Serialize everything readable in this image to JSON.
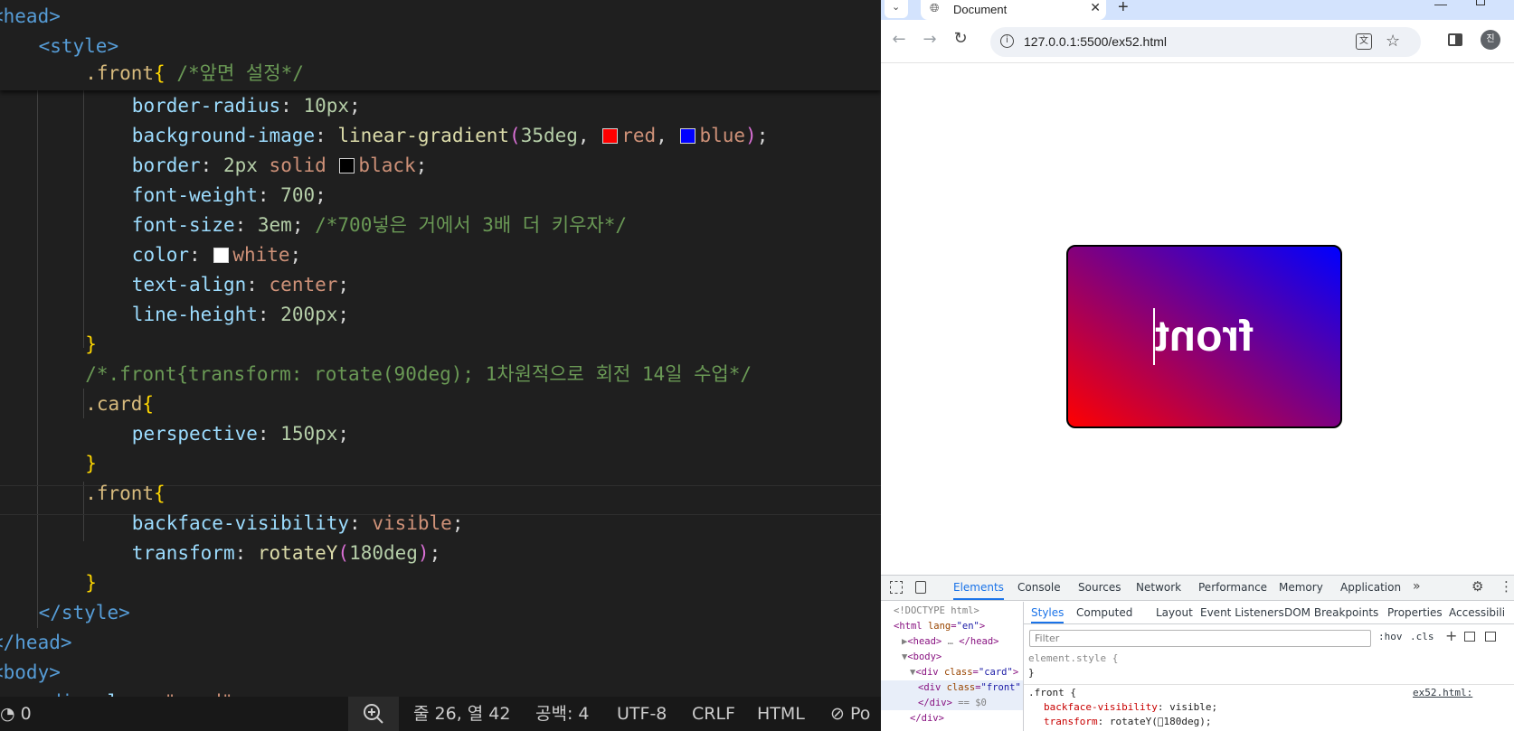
{
  "editor": {
    "lines": [
      {
        "indent": 0,
        "tokens": [
          [
            "tag",
            "<head>"
          ]
        ]
      },
      {
        "indent": 1,
        "tokens": [
          [
            "tag",
            "<style>"
          ]
        ]
      },
      {
        "indent": 2,
        "tokens": [
          [
            "sel",
            ".front"
          ],
          [
            "brace",
            "{"
          ],
          [
            "txt",
            " "
          ],
          [
            "cmt",
            "/*앞면 설정*/"
          ]
        ]
      },
      {
        "indent": 3,
        "tokens": [
          [
            "prop",
            "border-radius"
          ],
          [
            "txt",
            ": "
          ],
          [
            "num",
            "10px"
          ],
          [
            "txt",
            ";"
          ]
        ]
      },
      {
        "indent": 3,
        "tokens": [
          [
            "prop",
            "background-image"
          ],
          [
            "txt",
            ": "
          ],
          [
            "fn",
            "linear-gradient"
          ],
          [
            "paren",
            "("
          ],
          [
            "num",
            "35deg"
          ],
          [
            "txt",
            ", "
          ],
          [
            "swatch",
            "#ff0000"
          ],
          [
            "val",
            "red"
          ],
          [
            "txt",
            ", "
          ],
          [
            "swatch",
            "#0000ff"
          ],
          [
            "val",
            "blue"
          ],
          [
            "paren",
            ")"
          ],
          [
            "txt",
            ";"
          ]
        ]
      },
      {
        "indent": 3,
        "tokens": [
          [
            "prop",
            "border"
          ],
          [
            "txt",
            ": "
          ],
          [
            "num",
            "2px"
          ],
          [
            "txt",
            " "
          ],
          [
            "val",
            "solid"
          ],
          [
            "txt",
            " "
          ],
          [
            "swatch",
            "#000000"
          ],
          [
            "val",
            "black"
          ],
          [
            "txt",
            ";"
          ]
        ]
      },
      {
        "indent": 3,
        "tokens": [
          [
            "prop",
            "font-weight"
          ],
          [
            "txt",
            ": "
          ],
          [
            "num",
            "700"
          ],
          [
            "txt",
            ";"
          ]
        ]
      },
      {
        "indent": 3,
        "tokens": [
          [
            "prop",
            "font-size"
          ],
          [
            "txt",
            ": "
          ],
          [
            "num",
            "3em"
          ],
          [
            "txt",
            "; "
          ],
          [
            "cmt",
            "/*700넣은 거에서 3배 더 키우자*/"
          ]
        ]
      },
      {
        "indent": 3,
        "tokens": [
          [
            "prop",
            "color"
          ],
          [
            "txt",
            ": "
          ],
          [
            "swatch",
            "#ffffff"
          ],
          [
            "val",
            "white"
          ],
          [
            "txt",
            ";"
          ]
        ]
      },
      {
        "indent": 3,
        "tokens": [
          [
            "prop",
            "text-align"
          ],
          [
            "txt",
            ": "
          ],
          [
            "val",
            "center"
          ],
          [
            "txt",
            ";"
          ]
        ]
      },
      {
        "indent": 3,
        "tokens": [
          [
            "prop",
            "line-height"
          ],
          [
            "txt",
            ": "
          ],
          [
            "num",
            "200px"
          ],
          [
            "txt",
            ";"
          ]
        ]
      },
      {
        "indent": 2,
        "tokens": [
          [
            "brace",
            "}"
          ]
        ]
      },
      {
        "indent": 2,
        "tokens": [
          [
            "cmt",
            "/*.front{transform: rotate(90deg); 1차원적으로 회전 14일 수업*/"
          ]
        ]
      },
      {
        "indent": 2,
        "tokens": [
          [
            "sel",
            ".card"
          ],
          [
            "brace",
            "{"
          ]
        ]
      },
      {
        "indent": 3,
        "tokens": [
          [
            "prop",
            "perspective"
          ],
          [
            "txt",
            ": "
          ],
          [
            "num",
            "150px"
          ],
          [
            "txt",
            ";"
          ]
        ]
      },
      {
        "indent": 2,
        "tokens": [
          [
            "brace",
            "}"
          ]
        ]
      },
      {
        "indent": 2,
        "tokens": [
          [
            "sel",
            ".front"
          ],
          [
            "brace",
            "{"
          ]
        ]
      },
      {
        "indent": 3,
        "tokens": [
          [
            "prop",
            "backface-visibility"
          ],
          [
            "txt",
            ": "
          ],
          [
            "val",
            "visible"
          ],
          [
            "txt",
            ";"
          ]
        ]
      },
      {
        "indent": 3,
        "tokens": [
          [
            "prop",
            "transform"
          ],
          [
            "txt",
            ": "
          ],
          [
            "fn",
            "rotateY"
          ],
          [
            "paren",
            "("
          ],
          [
            "num",
            "180deg"
          ],
          [
            "paren",
            ")"
          ],
          [
            "txt",
            ";"
          ]
        ]
      },
      {
        "indent": 2,
        "tokens": [
          [
            "brace",
            "}"
          ]
        ]
      },
      {
        "indent": 1,
        "tokens": [
          [
            "tag",
            "</style>"
          ]
        ]
      },
      {
        "indent": 0,
        "tokens": [
          [
            "tag",
            "</head>"
          ]
        ]
      },
      {
        "indent": 0,
        "tokens": [
          [
            "tag",
            "<body>"
          ]
        ]
      },
      {
        "indent": 1,
        "tokens": [
          [
            "tag",
            "<div"
          ],
          [
            "txt",
            " "
          ],
          [
            "attr",
            "class"
          ],
          [
            "txt",
            "="
          ],
          [
            "str",
            "\"card\""
          ],
          [
            "tag",
            ">"
          ]
        ]
      }
    ]
  },
  "statusbar": {
    "problems": "0",
    "cursor": "줄 26, 열 42",
    "spaces": "공백: 4",
    "encoding": "UTF-8",
    "eol": "CRLF",
    "language": "HTML",
    "port": "Po"
  },
  "browser": {
    "tab_title": "Document",
    "url": "127.0.0.1:5500/ex52.html",
    "profile_initial": "진",
    "card_text": "front"
  },
  "devtools": {
    "tabs": [
      "Elements",
      "Console",
      "Sources",
      "Network",
      "Performance",
      "Memory",
      "Application"
    ],
    "active_tab": "Elements",
    "dom": [
      {
        "indent": 0,
        "parts": [
          [
            "gray",
            "<!DOCTYPE html>"
          ]
        ]
      },
      {
        "indent": 0,
        "parts": [
          [
            "tag",
            "<html "
          ],
          [
            "attr",
            "lang"
          ],
          [
            "tag",
            "="
          ],
          [
            "val",
            "\"en\""
          ],
          [
            "tag",
            ">"
          ]
        ]
      },
      {
        "indent": 1,
        "parts": [
          [
            "gray",
            "▶"
          ],
          [
            "tag",
            "<head>"
          ],
          [
            "gray",
            " … "
          ],
          [
            "tag",
            "</head>"
          ]
        ]
      },
      {
        "indent": 1,
        "parts": [
          [
            "gray",
            "▼"
          ],
          [
            "tag",
            "<body>"
          ]
        ]
      },
      {
        "indent": 2,
        "parts": [
          [
            "gray",
            "▼"
          ],
          [
            "tag",
            "<div "
          ],
          [
            "attr",
            "class"
          ],
          [
            "tag",
            "="
          ],
          [
            "val",
            "\"card\""
          ],
          [
            "tag",
            ">"
          ]
        ]
      },
      {
        "indent": 3,
        "parts": [
          [
            "tag",
            "<div "
          ],
          [
            "attr",
            "class"
          ],
          [
            "tag",
            "="
          ],
          [
            "val",
            "\"front\""
          ]
        ]
      },
      {
        "indent": 3,
        "parts": [
          [
            "tag",
            "</div>"
          ],
          [
            "gray",
            " == $0"
          ]
        ]
      },
      {
        "indent": 2,
        "parts": [
          [
            "tag",
            "</div>"
          ]
        ]
      }
    ],
    "sub_tabs": [
      "Styles",
      "Computed",
      "Layout",
      "Event Listeners",
      "DOM Breakpoints",
      "Properties",
      "Accessibili"
    ],
    "filter_placeholder": "Filter",
    "hov": ":hov",
    "cls": ".cls",
    "element_style": "element.style {",
    "close_brace": "}",
    "rule_selector": ".front {",
    "rule_source": "ex52.html:",
    "rule_props": [
      {
        "prop": "backface-visibility",
        "value": "visible;"
      },
      {
        "prop": "transform",
        "value": "rotateY(⃝180deg);"
      }
    ]
  }
}
